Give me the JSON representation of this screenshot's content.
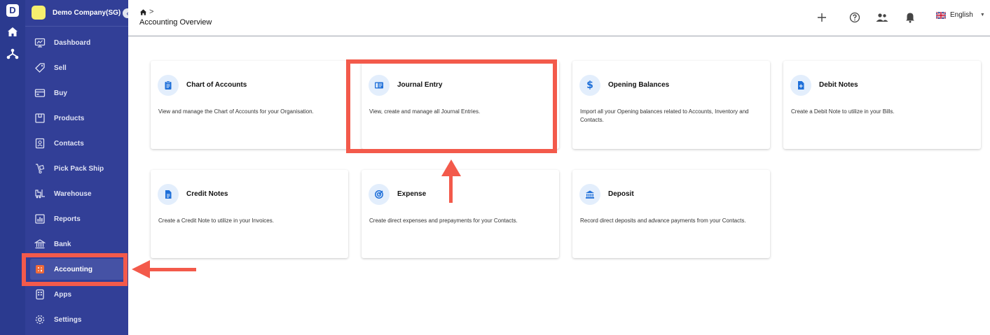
{
  "app": {
    "logo_letter": "D",
    "company": "Demo Company(SG)"
  },
  "sidebar": {
    "items": [
      {
        "label": "Dashboard",
        "icon": "dashboard-icon"
      },
      {
        "label": "Sell",
        "icon": "tag-icon"
      },
      {
        "label": "Buy",
        "icon": "cart-icon"
      },
      {
        "label": "Products",
        "icon": "box-icon"
      },
      {
        "label": "Contacts",
        "icon": "contact-book-icon"
      },
      {
        "label": "Pick Pack Ship",
        "icon": "hand-truck-icon"
      },
      {
        "label": "Warehouse",
        "icon": "forklift-icon"
      },
      {
        "label": "Reports",
        "icon": "report-chart-icon"
      },
      {
        "label": "Bank",
        "icon": "bank-icon"
      },
      {
        "label": "Accounting",
        "icon": "accounting-icon",
        "active": true
      },
      {
        "label": "Apps",
        "icon": "apps-icon"
      },
      {
        "label": "Settings",
        "icon": "gear-icon"
      }
    ]
  },
  "header": {
    "breadcrumb_sep": ">",
    "title": "Accounting Overview",
    "language": "English"
  },
  "cards": [
    {
      "title": "Chart of Accounts",
      "desc": "View and manage the Chart of Accounts for your Organisation.",
      "icon": "clipboard-icon"
    },
    {
      "title": "Journal Entry",
      "desc": "View, create and manage all Journal Entries.",
      "icon": "journal-icon"
    },
    {
      "title": "Opening Balances",
      "desc": "Import all your Opening balances related to Accounts, Inventory and Contacts.",
      "icon": "dollar-icon"
    },
    {
      "title": "Debit Notes",
      "desc": "Create a Debit Note to utilize in your Bills.",
      "icon": "debit-note-icon"
    },
    {
      "title": "Credit Notes",
      "desc": "Create a Credit Note to utilize in your Invoices.",
      "icon": "credit-note-icon"
    },
    {
      "title": "Expense",
      "desc": "Create direct expenses and prepayments for your Contacts.",
      "icon": "expense-icon"
    },
    {
      "title": "Deposit",
      "desc": "Record direct deposits and advance payments from your Contacts.",
      "icon": "bank-building-icon"
    }
  ],
  "colors": {
    "sidebar": "#323f97",
    "rail": "#2b3a8f",
    "accent": "#1e6fd9",
    "annotation": "#f35a4b"
  }
}
